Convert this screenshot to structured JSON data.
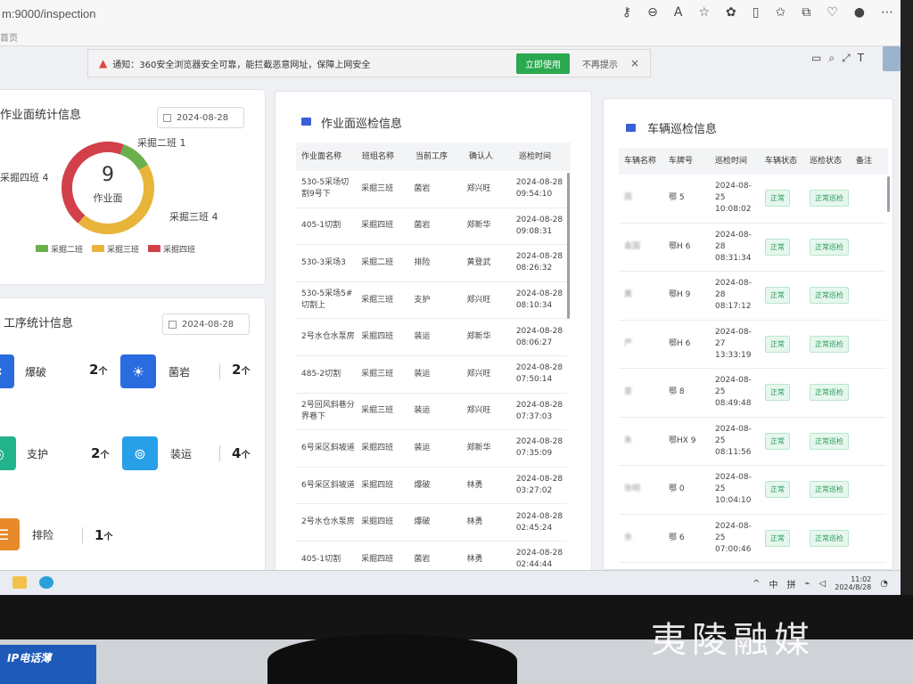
{
  "browser": {
    "address": "m:9000/inspection",
    "tab_fragment": "首页"
  },
  "notification": {
    "message": "通知：360安全浏览器安全可靠，能拦截恶意网址，保障上网安全",
    "use_now": "立即使用",
    "dont_remind": "不再提示",
    "close": "×"
  },
  "face_stats": {
    "title": "作业面统计信息",
    "date": "2024-08-28",
    "total": "9",
    "total_label": "作业面",
    "slices": [
      {
        "label": "采掘二班 1",
        "legend": "采掘二班",
        "value": 1,
        "color": "#6ab04c"
      },
      {
        "label": "采掘三班 4",
        "legend": "采掘三班",
        "value": 4,
        "color": "#e8b43a"
      },
      {
        "label": "采掘四班 4",
        "legend": "采掘四班",
        "value": 4,
        "color": "#d2404a"
      }
    ]
  },
  "process_stats": {
    "title": "工序统计信息",
    "date": "2024-08-28",
    "unit": "个",
    "items": [
      {
        "name": "爆破",
        "count": "2",
        "color": "#2a6be0",
        "icon": "blast-icon"
      },
      {
        "name": "菌岩",
        "count": "2",
        "color": "#2a6be0",
        "icon": "lightbulb-icon"
      },
      {
        "name": "支护",
        "count": "2",
        "color": "#22b38a",
        "icon": "support-icon"
      },
      {
        "name": "装运",
        "count": "4",
        "color": "#27a0e8",
        "icon": "loading-icon"
      },
      {
        "name": "排险",
        "count": "1",
        "color": "#e88a2a",
        "icon": "list-icon"
      }
    ]
  },
  "face_inspection": {
    "title": "作业面巡检信息",
    "headers": [
      "作业面名称",
      "班组名称",
      "当前工序",
      "确认人",
      "巡检时间"
    ],
    "rows": [
      [
        "530-5采场切割9号下",
        "采掘三班",
        "菌岩",
        "郑兴旺",
        "2024-08-28 09:54:10"
      ],
      [
        "405-1切割",
        "采掘四班",
        "菌岩",
        "郑新华",
        "2024-08-28 09:08:31"
      ],
      [
        "530-3采场3",
        "采掘二班",
        "排险",
        "黄登武",
        "2024-08-28 08:26:32"
      ],
      [
        "530-5采场5#切割上",
        "采掘三班",
        "支护",
        "郑兴旺",
        "2024-08-28 08:10:34"
      ],
      [
        "2号水仓水泵房",
        "采掘四班",
        "装运",
        "郑新华",
        "2024-08-28 08:06:27"
      ],
      [
        "485-2切割",
        "采掘三班",
        "装运",
        "郑兴旺",
        "2024-08-28 07:50:14"
      ],
      [
        "2号回风斜巷分界巷下",
        "采掘三班",
        "装运",
        "郑兴旺",
        "2024-08-28 07:37:03"
      ],
      [
        "6号采区斜坡道",
        "采掘四班",
        "装运",
        "郑新华",
        "2024-08-28 07:35:09"
      ],
      [
        "6号采区斜坡道",
        "采掘四班",
        "爆破",
        "林勇",
        "2024-08-28 03:27:02"
      ],
      [
        "2号水仓水泵房",
        "采掘四班",
        "爆破",
        "林勇",
        "2024-08-28 02:45:24"
      ],
      [
        "405-1切割",
        "采掘四班",
        "菌岩",
        "林勇",
        "2024-08-28 02:44:44"
      ]
    ]
  },
  "vehicle_inspection": {
    "title": "车辆巡检信息",
    "headers": [
      "车辆名称",
      "车牌号",
      "巡检时间",
      "车辆状态",
      "巡检状态",
      "备注"
    ],
    "rows": [
      [
        "周",
        "鄂 5",
        "2024-08-25 10:08:02",
        "正常",
        "正常巡检",
        ""
      ],
      [
        "袁国",
        "鄂H 6",
        "2024-08-28 08:31:34",
        "正常",
        "正常巡检",
        ""
      ],
      [
        "黄",
        "鄂H 9",
        "2024-08-28 08:17:12",
        "正常",
        "正常巡检",
        ""
      ],
      [
        "严",
        "鄂H 6",
        "2024-08-27 13:33:19",
        "正常",
        "正常巡检",
        ""
      ],
      [
        "姜",
        "鄂 8",
        "2024-08-25 08:49:48",
        "正常",
        "正常巡检",
        ""
      ],
      [
        "朱",
        "鄂HX 9",
        "2024-08-25 08:11:56",
        "正常",
        "正常巡检",
        ""
      ],
      [
        "张明",
        "鄂 0",
        "2024-08-25 10:04:10",
        "正常",
        "正常巡检",
        ""
      ],
      [
        "余",
        "鄂 6",
        "2024-08-25 07:00:46",
        "正常",
        "正常巡检",
        ""
      ]
    ]
  },
  "taskbar": {
    "ime1": "中",
    "ime2": "拼",
    "time": "11:02",
    "date": "2024/8/28"
  },
  "placard": "IP电话薄",
  "watermark": "夷陵融媒"
}
